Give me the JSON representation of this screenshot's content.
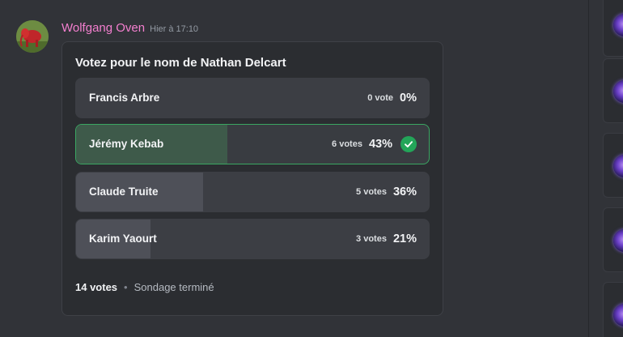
{
  "message": {
    "username": "Wolfgang Oven",
    "timestamp": "Hier à 17:10",
    "username_color": "#f47fcf"
  },
  "poll": {
    "question": "Votez pour le nom de Nathan Delcart",
    "answers": [
      {
        "label": "Francis Arbre",
        "votes": "0 vote",
        "percent": "0%",
        "fraction": 0.0,
        "selected": false
      },
      {
        "label": "Jérémy Kebab",
        "votes": "6 votes",
        "percent": "43%",
        "fraction": 0.43,
        "selected": true
      },
      {
        "label": "Claude Truite",
        "votes": "5 votes",
        "percent": "36%",
        "fraction": 0.36,
        "selected": false
      },
      {
        "label": "Karim Yaourt",
        "votes": "3 votes",
        "percent": "21%",
        "fraction": 0.21,
        "selected": false
      }
    ],
    "total_votes": "14 votes",
    "separator": "•",
    "status": "Sondage terminé",
    "accent_color": "#23a559"
  },
  "icons": {
    "avatar": "avatar-image",
    "check": "check-icon",
    "side_thumb": "embed-thumbnail"
  }
}
